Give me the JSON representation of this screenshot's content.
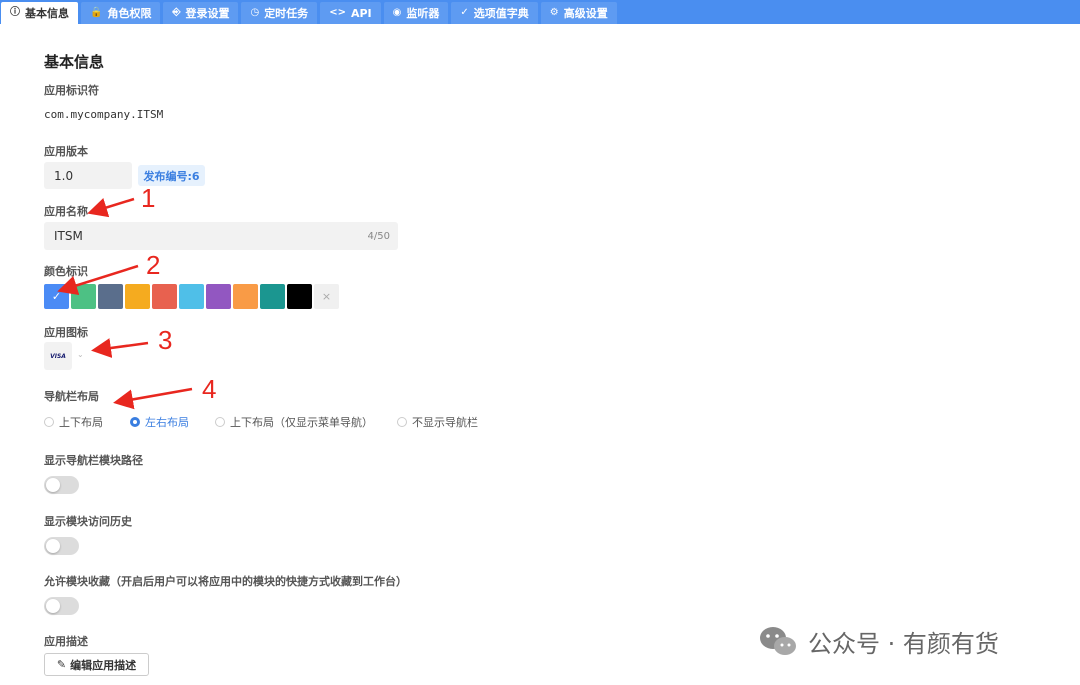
{
  "tabs": [
    {
      "label": "基本信息",
      "icon": "info-icon",
      "glyph": "ⓘ",
      "active": true
    },
    {
      "label": "角色权限",
      "icon": "lock-icon",
      "glyph": "🔒",
      "active": false
    },
    {
      "label": "登录设置",
      "icon": "login-icon",
      "glyph": "⎆",
      "active": false
    },
    {
      "label": "定时任务",
      "icon": "clock-icon",
      "glyph": "◷",
      "active": false
    },
    {
      "label": "API",
      "icon": "code-icon",
      "glyph": "<>",
      "active": false
    },
    {
      "label": "监听器",
      "icon": "eye-icon",
      "glyph": "◉",
      "active": false
    },
    {
      "label": "选项值字典",
      "icon": "check-circle-icon",
      "glyph": "✓",
      "active": false
    },
    {
      "label": "高级设置",
      "icon": "gear-icon",
      "glyph": "⚙",
      "active": false
    }
  ],
  "page": {
    "title": "基本信息",
    "app_id_label": "应用标识符",
    "app_id_value": "com.mycompany.ITSM",
    "version_label": "应用版本",
    "version_value": "1.0",
    "release_badge": "发布编号:6",
    "name_label": "应用名称",
    "name_value": "ITSM",
    "name_counter": "4/50",
    "color_label": "颜色标识",
    "icon_label": "应用图标",
    "icon_text": "VISA",
    "nav_label": "导航栏布局",
    "nav_options": [
      "上下布局",
      "左右布局",
      "上下布局（仅显示菜单导航）",
      "不显示导航栏"
    ],
    "nav_selected": 1,
    "show_path_label": "显示导航栏模块路径",
    "show_history_label": "显示模块访问历史",
    "allow_fav_label": "允许模块收藏（开启后用户可以将应用中的模块的快捷方式收藏到工作台）",
    "desc_label": "应用描述",
    "edit_desc_button": "编辑应用描述"
  },
  "colors": [
    "#4b8bf5",
    "#4dc184",
    "#5a6e8c",
    "#f5ab1f",
    "#e8614f",
    "#4fbfe8",
    "#9257c1",
    "#f99b46",
    "#1b9690",
    "#000000"
  ],
  "selected_color": 0,
  "toggles": {
    "show_path": false,
    "show_history": false,
    "allow_fav": false
  },
  "annotations": [
    "1",
    "2",
    "3",
    "4"
  ],
  "watermark": {
    "text": "公众号 · 有颜有货"
  }
}
